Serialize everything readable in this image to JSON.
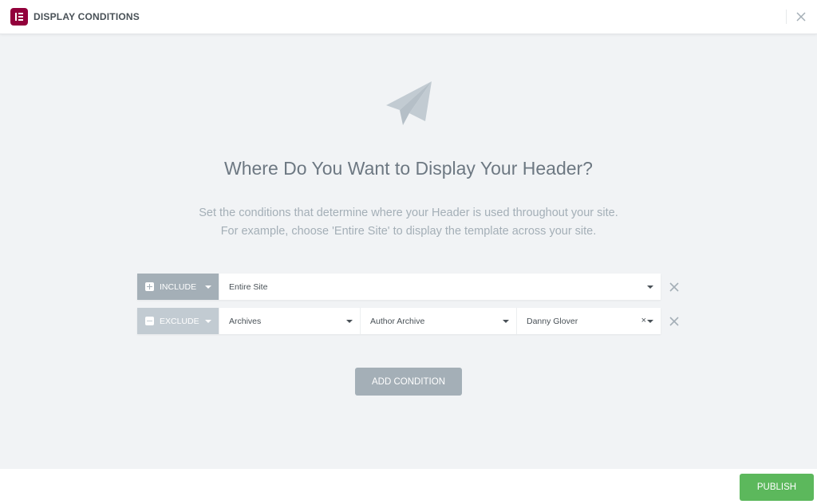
{
  "header": {
    "title": "DISPLAY CONDITIONS",
    "logo_icon": "elementor-logo-icon",
    "close_icon": "close-icon"
  },
  "hero": {
    "icon": "paper-plane-icon",
    "headline": "Where Do You Want to Display Your Header?",
    "description_line1": "Set the conditions that determine where your Header is used throughout your site.",
    "description_line2": "For example, choose 'Entire Site' to display the template across your site."
  },
  "conditions": [
    {
      "type": "INCLUDE",
      "type_icon": "plus-square-icon",
      "selects": [
        "Entire Site"
      ]
    },
    {
      "type": "EXCLUDE",
      "type_icon": "minus-square-icon",
      "selects": [
        "Archives",
        "Author Archive",
        "Danny Glover"
      ],
      "clear_label": "×"
    }
  ],
  "add_condition_label": "ADD CONDITION",
  "footer": {
    "publish_label": "PUBLISH"
  },
  "colors": {
    "brand": "#92003b",
    "include": "#a4afb7",
    "exclude": "#c2cbd2",
    "publish": "#5cb85c",
    "background": "#f1f3f5"
  }
}
